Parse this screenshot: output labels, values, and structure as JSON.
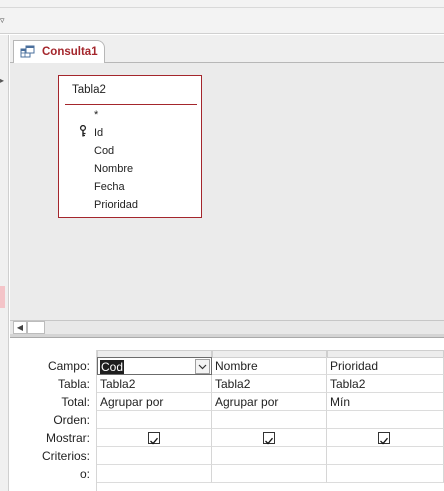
{
  "document_tab": {
    "label": "Consulta1"
  },
  "table_box": {
    "title": "Tabla2",
    "fields": [
      "*",
      "Id",
      "Cod",
      "Nombre",
      "Fecha",
      "Prioridad"
    ],
    "primary_key_field": "Id"
  },
  "grid": {
    "row_labels": {
      "campo": "Campo:",
      "tabla": "Tabla:",
      "total": "Total:",
      "orden": "Orden:",
      "mostrar": "Mostrar:",
      "criterios": "Criterios:",
      "o": "o:"
    },
    "columns": [
      {
        "campo": "Cod",
        "tabla": "Tabla2",
        "total": "Agrupar por",
        "orden": "",
        "mostrar": true,
        "criterios": "",
        "o": "",
        "active": true
      },
      {
        "campo": "Nombre",
        "tabla": "Tabla2",
        "total": "Agrupar por",
        "orden": "",
        "mostrar": true,
        "criterios": "",
        "o": ""
      },
      {
        "campo": "Prioridad",
        "tabla": "Tabla2",
        "total": "Mín",
        "orden": "",
        "mostrar": true,
        "criterios": "",
        "o": ""
      }
    ]
  },
  "colors": {
    "accent": "#a4262c",
    "tab_text": "#a4262c",
    "selection": "#1e1e1e"
  }
}
